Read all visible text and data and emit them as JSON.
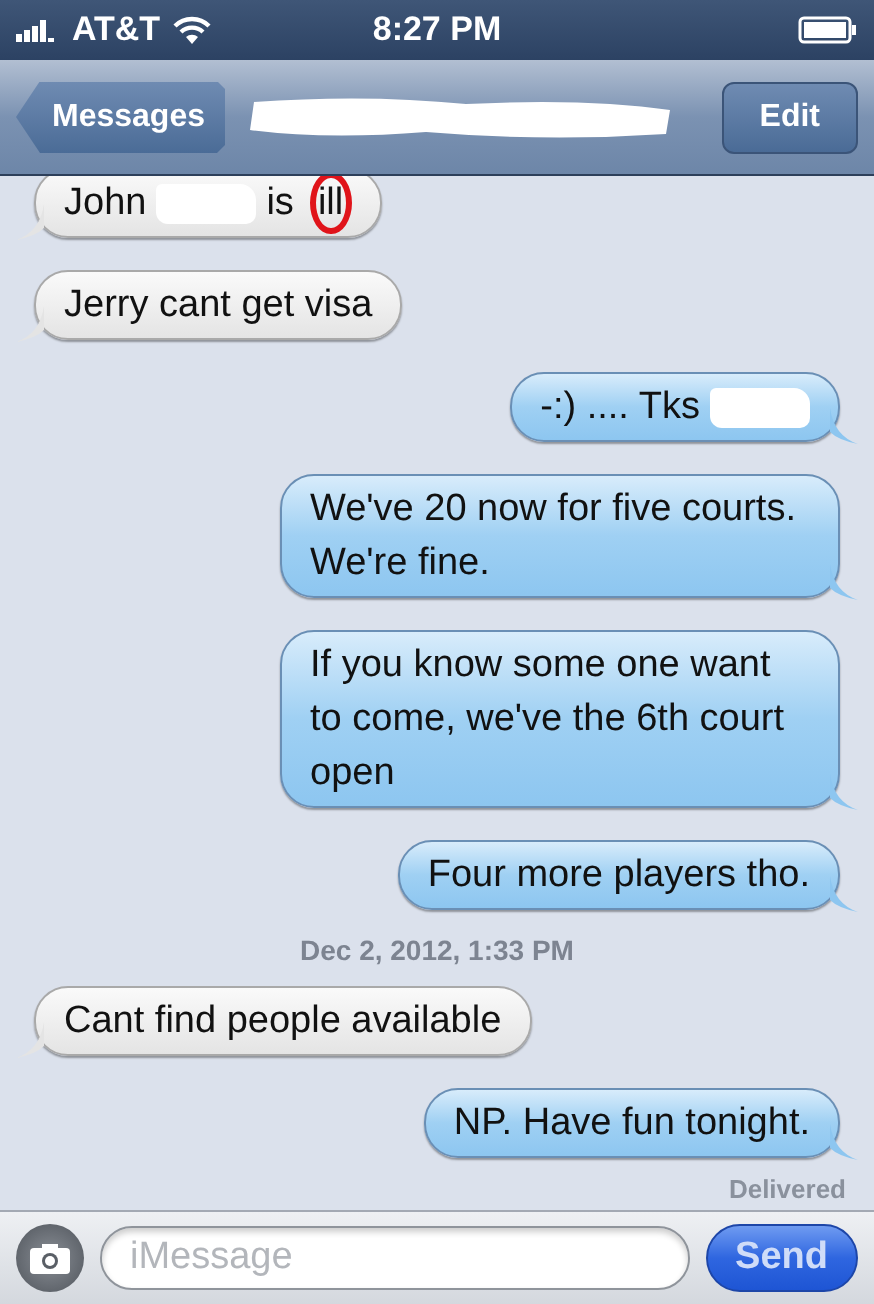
{
  "status_bar": {
    "carrier": "AT&T",
    "time": "8:27 PM"
  },
  "nav_bar": {
    "back": "Messages",
    "title_redacted": true,
    "action": "Edit"
  },
  "messages": [
    {
      "kind": "message",
      "outgoing": false,
      "segments": [
        {
          "kind": "text",
          "text": "John"
        },
        {
          "kind": "redaction"
        },
        {
          "kind": "text",
          "text": "is"
        },
        {
          "kind": "text",
          "text": "ill",
          "circled": true
        }
      ]
    },
    {
      "kind": "message",
      "outgoing": false,
      "segments": [
        {
          "kind": "text",
          "text": "Jerry cant get visa"
        }
      ]
    },
    {
      "kind": "message",
      "outgoing": true,
      "segments": [
        {
          "kind": "text",
          "text": "-:) .... Tks"
        },
        {
          "kind": "redaction"
        }
      ]
    },
    {
      "kind": "message",
      "outgoing": true,
      "segments": [
        {
          "kind": "text",
          "text": "We've 20 now for five courts. We're fine."
        }
      ]
    },
    {
      "kind": "message",
      "outgoing": true,
      "segments": [
        {
          "kind": "text",
          "text": "If you know some one want to come, we've the 6th court open"
        }
      ]
    },
    {
      "kind": "message",
      "outgoing": true,
      "segments": [
        {
          "kind": "text",
          "text": "Four more players tho."
        }
      ]
    },
    {
      "kind": "timestamp",
      "text": "Dec 2, 2012, 1:33 PM"
    },
    {
      "kind": "message",
      "outgoing": false,
      "segments": [
        {
          "kind": "text",
          "text": "Cant find people available"
        }
      ]
    },
    {
      "kind": "message",
      "outgoing": true,
      "segments": [
        {
          "kind": "text",
          "text": "NP. Have fun tonight."
        }
      ]
    },
    {
      "kind": "receipt",
      "text": "Delivered"
    }
  ],
  "composer": {
    "placeholder": "iMessage",
    "send": "Send"
  }
}
